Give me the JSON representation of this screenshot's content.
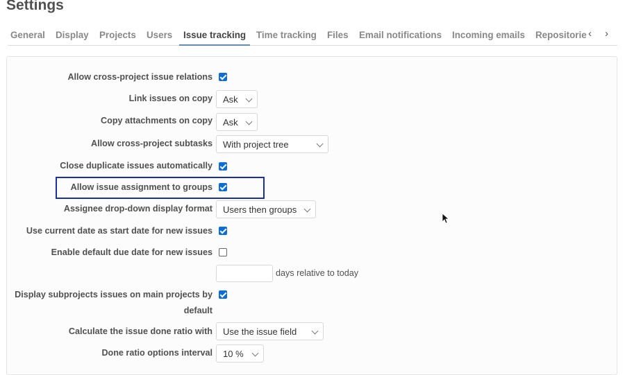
{
  "page": {
    "title": "Settings"
  },
  "tabs": [
    {
      "label": "General"
    },
    {
      "label": "Display"
    },
    {
      "label": "Projects"
    },
    {
      "label": "Users"
    },
    {
      "label": "Issue tracking",
      "selected": true
    },
    {
      "label": "Time tracking"
    },
    {
      "label": "Files"
    },
    {
      "label": "Email notifications"
    },
    {
      "label": "Incoming emails"
    },
    {
      "label": "Repositories"
    }
  ],
  "settings": {
    "cross_project_relations": {
      "label": "Allow cross-project issue relations",
      "checked": true
    },
    "link_on_copy": {
      "label": "Link issues on copy",
      "value": "Ask"
    },
    "copy_attachments": {
      "label": "Copy attachments on copy",
      "value": "Ask"
    },
    "cross_project_subtasks": {
      "label": "Allow cross-project subtasks",
      "value": "With project tree"
    },
    "close_duplicates": {
      "label": "Close duplicate issues automatically",
      "checked": true
    },
    "group_assignment": {
      "label": "Allow issue assignment to groups",
      "checked": true
    },
    "assignee_format": {
      "label": "Assignee drop-down display format",
      "value": "Users then groups"
    },
    "current_date_start": {
      "label": "Use current date as start date for new issues",
      "checked": true
    },
    "default_due_date": {
      "label": "Enable default due date for new issues",
      "checked": false
    },
    "due_days": {
      "value": "",
      "suffix": "days relative to today"
    },
    "subprojects_issues": {
      "label_line1": "Display subprojects issues on main projects by",
      "label_line2": "default",
      "checked": true
    },
    "done_ratio": {
      "label": "Calculate the issue done ratio with",
      "value": "Use the issue field"
    },
    "done_ratio_interval": {
      "label": "Done ratio options interval",
      "value": "10 %"
    }
  },
  "colors": {
    "accent": "#628db6",
    "checkbox": "#0a6dd9",
    "highlight": "#1a2fa3"
  }
}
